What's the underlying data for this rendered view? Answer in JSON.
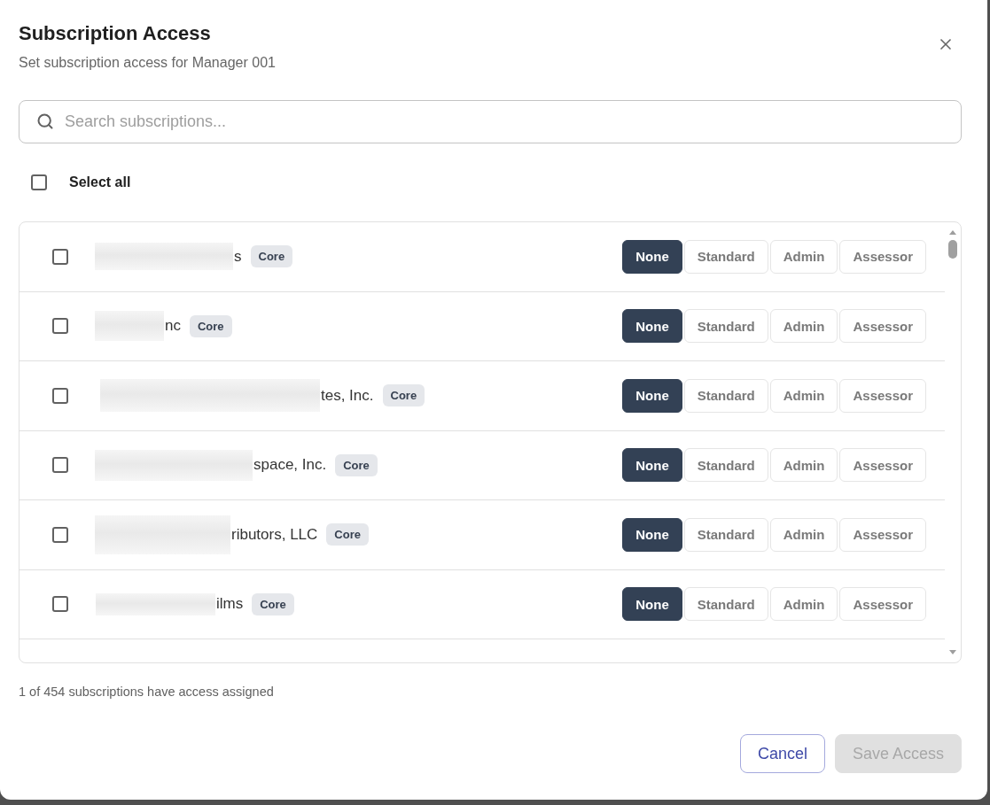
{
  "dialog": {
    "title": "Subscription Access",
    "subtitle": "Set subscription access for Manager 001"
  },
  "search": {
    "placeholder": "Search subscriptions..."
  },
  "select_all": {
    "label": "Select all",
    "checked": false
  },
  "subscriptions": [
    {
      "name": "s",
      "redacted": true,
      "tag": "Core",
      "checked": false,
      "access": [
        {
          "label": "None",
          "selected": true
        },
        {
          "label": "Standard",
          "selected": false
        },
        {
          "label": "Admin",
          "selected": false
        },
        {
          "label": "Assessor",
          "selected": false
        }
      ]
    },
    {
      "name": "nc",
      "redacted": true,
      "tag": "Core",
      "checked": false,
      "access": [
        {
          "label": "None",
          "selected": true
        },
        {
          "label": "Standard",
          "selected": false
        },
        {
          "label": "Admin",
          "selected": false
        },
        {
          "label": "Assessor",
          "selected": false
        }
      ]
    },
    {
      "name": "tes, Inc.",
      "redacted": true,
      "tag": "Core",
      "checked": false,
      "access": [
        {
          "label": "None",
          "selected": true
        },
        {
          "label": "Standard",
          "selected": false
        },
        {
          "label": "Admin",
          "selected": false
        },
        {
          "label": "Assessor",
          "selected": false
        }
      ]
    },
    {
      "name": "space, Inc.",
      "redacted": true,
      "tag": "Core",
      "checked": false,
      "access": [
        {
          "label": "None",
          "selected": true
        },
        {
          "label": "Standard",
          "selected": false
        },
        {
          "label": "Admin",
          "selected": false
        },
        {
          "label": "Assessor",
          "selected": false
        }
      ]
    },
    {
      "name": "ributors, LLC",
      "redacted": true,
      "tag": "Core",
      "checked": false,
      "access": [
        {
          "label": "None",
          "selected": true
        },
        {
          "label": "Standard",
          "selected": false
        },
        {
          "label": "Admin",
          "selected": false
        },
        {
          "label": "Assessor",
          "selected": false
        }
      ]
    },
    {
      "name": "ilms",
      "redacted": true,
      "tag": "Core",
      "checked": false,
      "access": [
        {
          "label": "None",
          "selected": true
        },
        {
          "label": "Standard",
          "selected": false
        },
        {
          "label": "Admin",
          "selected": false
        },
        {
          "label": "Assessor",
          "selected": false
        }
      ]
    }
  ],
  "summary": "1 of 454 subscriptions have access assigned",
  "buttons": [
    {
      "label": "Cancel",
      "kind": "secondary",
      "disabled": false
    },
    {
      "label": "Save Access",
      "kind": "primary",
      "disabled": true
    }
  ]
}
